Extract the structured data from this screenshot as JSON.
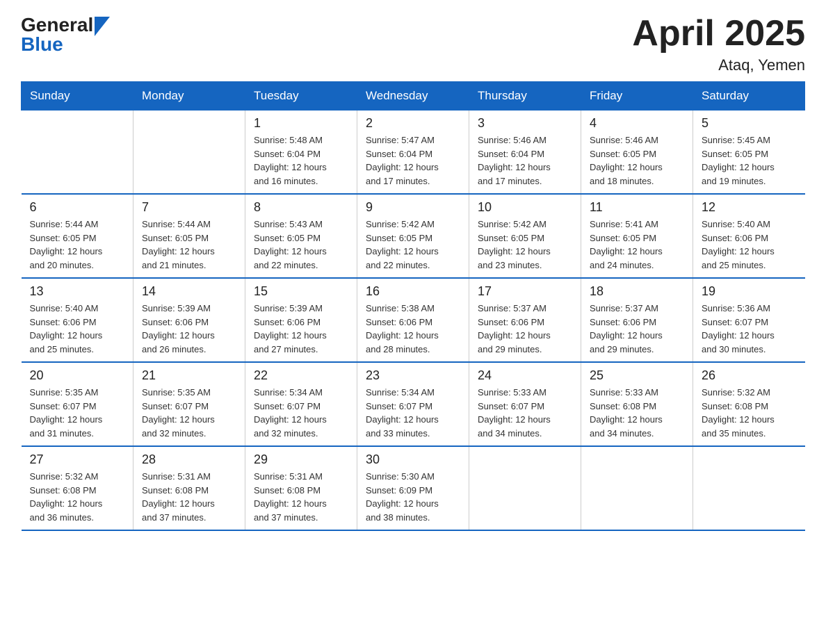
{
  "logo": {
    "general": "General",
    "blue": "Blue"
  },
  "header": {
    "title": "April 2025",
    "subtitle": "Ataq, Yemen"
  },
  "weekdays": [
    "Sunday",
    "Monday",
    "Tuesday",
    "Wednesday",
    "Thursday",
    "Friday",
    "Saturday"
  ],
  "weeks": [
    [
      {
        "day": "",
        "info": ""
      },
      {
        "day": "",
        "info": ""
      },
      {
        "day": "1",
        "info": "Sunrise: 5:48 AM\nSunset: 6:04 PM\nDaylight: 12 hours\nand 16 minutes."
      },
      {
        "day": "2",
        "info": "Sunrise: 5:47 AM\nSunset: 6:04 PM\nDaylight: 12 hours\nand 17 minutes."
      },
      {
        "day": "3",
        "info": "Sunrise: 5:46 AM\nSunset: 6:04 PM\nDaylight: 12 hours\nand 17 minutes."
      },
      {
        "day": "4",
        "info": "Sunrise: 5:46 AM\nSunset: 6:05 PM\nDaylight: 12 hours\nand 18 minutes."
      },
      {
        "day": "5",
        "info": "Sunrise: 5:45 AM\nSunset: 6:05 PM\nDaylight: 12 hours\nand 19 minutes."
      }
    ],
    [
      {
        "day": "6",
        "info": "Sunrise: 5:44 AM\nSunset: 6:05 PM\nDaylight: 12 hours\nand 20 minutes."
      },
      {
        "day": "7",
        "info": "Sunrise: 5:44 AM\nSunset: 6:05 PM\nDaylight: 12 hours\nand 21 minutes."
      },
      {
        "day": "8",
        "info": "Sunrise: 5:43 AM\nSunset: 6:05 PM\nDaylight: 12 hours\nand 22 minutes."
      },
      {
        "day": "9",
        "info": "Sunrise: 5:42 AM\nSunset: 6:05 PM\nDaylight: 12 hours\nand 22 minutes."
      },
      {
        "day": "10",
        "info": "Sunrise: 5:42 AM\nSunset: 6:05 PM\nDaylight: 12 hours\nand 23 minutes."
      },
      {
        "day": "11",
        "info": "Sunrise: 5:41 AM\nSunset: 6:05 PM\nDaylight: 12 hours\nand 24 minutes."
      },
      {
        "day": "12",
        "info": "Sunrise: 5:40 AM\nSunset: 6:06 PM\nDaylight: 12 hours\nand 25 minutes."
      }
    ],
    [
      {
        "day": "13",
        "info": "Sunrise: 5:40 AM\nSunset: 6:06 PM\nDaylight: 12 hours\nand 25 minutes."
      },
      {
        "day": "14",
        "info": "Sunrise: 5:39 AM\nSunset: 6:06 PM\nDaylight: 12 hours\nand 26 minutes."
      },
      {
        "day": "15",
        "info": "Sunrise: 5:39 AM\nSunset: 6:06 PM\nDaylight: 12 hours\nand 27 minutes."
      },
      {
        "day": "16",
        "info": "Sunrise: 5:38 AM\nSunset: 6:06 PM\nDaylight: 12 hours\nand 28 minutes."
      },
      {
        "day": "17",
        "info": "Sunrise: 5:37 AM\nSunset: 6:06 PM\nDaylight: 12 hours\nand 29 minutes."
      },
      {
        "day": "18",
        "info": "Sunrise: 5:37 AM\nSunset: 6:06 PM\nDaylight: 12 hours\nand 29 minutes."
      },
      {
        "day": "19",
        "info": "Sunrise: 5:36 AM\nSunset: 6:07 PM\nDaylight: 12 hours\nand 30 minutes."
      }
    ],
    [
      {
        "day": "20",
        "info": "Sunrise: 5:35 AM\nSunset: 6:07 PM\nDaylight: 12 hours\nand 31 minutes."
      },
      {
        "day": "21",
        "info": "Sunrise: 5:35 AM\nSunset: 6:07 PM\nDaylight: 12 hours\nand 32 minutes."
      },
      {
        "day": "22",
        "info": "Sunrise: 5:34 AM\nSunset: 6:07 PM\nDaylight: 12 hours\nand 32 minutes."
      },
      {
        "day": "23",
        "info": "Sunrise: 5:34 AM\nSunset: 6:07 PM\nDaylight: 12 hours\nand 33 minutes."
      },
      {
        "day": "24",
        "info": "Sunrise: 5:33 AM\nSunset: 6:07 PM\nDaylight: 12 hours\nand 34 minutes."
      },
      {
        "day": "25",
        "info": "Sunrise: 5:33 AM\nSunset: 6:08 PM\nDaylight: 12 hours\nand 34 minutes."
      },
      {
        "day": "26",
        "info": "Sunrise: 5:32 AM\nSunset: 6:08 PM\nDaylight: 12 hours\nand 35 minutes."
      }
    ],
    [
      {
        "day": "27",
        "info": "Sunrise: 5:32 AM\nSunset: 6:08 PM\nDaylight: 12 hours\nand 36 minutes."
      },
      {
        "day": "28",
        "info": "Sunrise: 5:31 AM\nSunset: 6:08 PM\nDaylight: 12 hours\nand 37 minutes."
      },
      {
        "day": "29",
        "info": "Sunrise: 5:31 AM\nSunset: 6:08 PM\nDaylight: 12 hours\nand 37 minutes."
      },
      {
        "day": "30",
        "info": "Sunrise: 5:30 AM\nSunset: 6:09 PM\nDaylight: 12 hours\nand 38 minutes."
      },
      {
        "day": "",
        "info": ""
      },
      {
        "day": "",
        "info": ""
      },
      {
        "day": "",
        "info": ""
      }
    ]
  ]
}
